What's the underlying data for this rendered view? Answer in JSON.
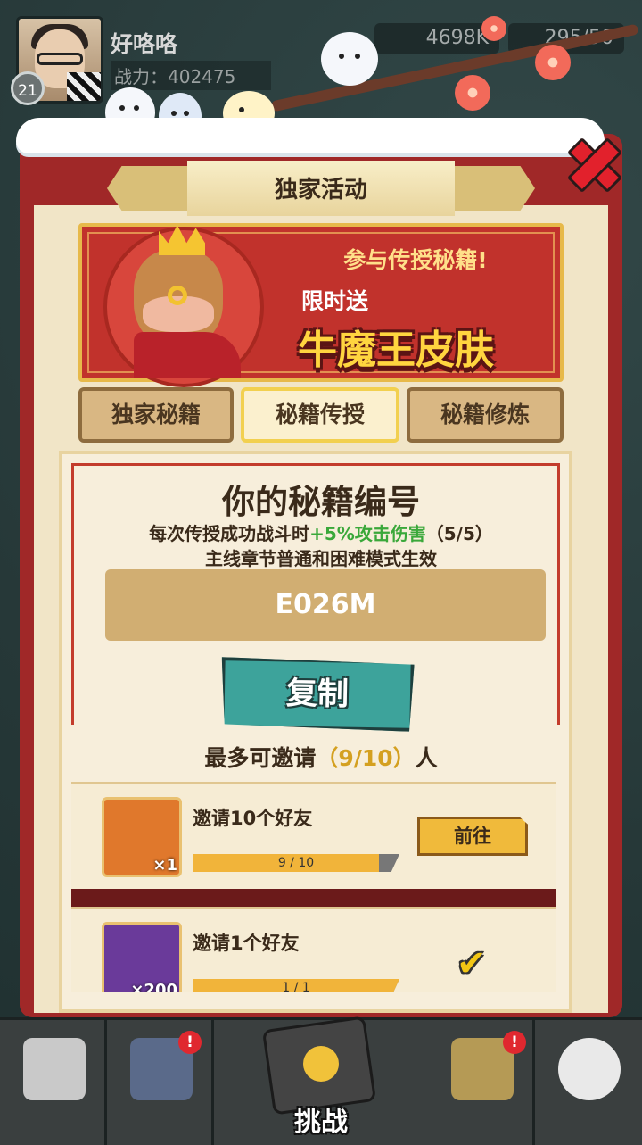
{
  "player": {
    "name": "好咯咯",
    "power": "战力：402475",
    "level": "21"
  },
  "resources": {
    "coins": "4698K",
    "energy": "295/50"
  },
  "panel": {
    "title": "独家活动"
  },
  "banner": {
    "line1": "参与传授秘籍!",
    "line2": "限时送",
    "line3": "牛魔王皮肤"
  },
  "tabs": [
    {
      "label": "独家秘籍",
      "active": false
    },
    {
      "label": "秘籍传授",
      "active": true
    },
    {
      "label": "秘籍修炼",
      "active": false
    }
  ],
  "card": {
    "title": "你的秘籍编号",
    "desc_prefix": "每次传授成功战斗时",
    "desc_bonus": "+5%攻击伤害",
    "desc_count": "（5/5）",
    "desc_line2": "主线章节普通和困难模式生效",
    "code": "E026M",
    "copy_label": "复制",
    "invite_prefix": "最多可邀请",
    "invite_count": "（9/10）",
    "invite_suffix": "人"
  },
  "tasks": [
    {
      "label": "邀请10个好友",
      "reward_count": "×1",
      "progress_text": "9 / 10",
      "progress": 0.9,
      "action": "前往",
      "done": false
    },
    {
      "label": "邀请1个好友",
      "reward_count": "×200",
      "progress_text": "1 / 1",
      "progress": 1.0,
      "action": "",
      "done": true
    }
  ],
  "nav": {
    "challenge_label": "挑战",
    "badge": "!"
  },
  "colors": {
    "panel_red": "#a02828",
    "accent_gold": "#f1b43a",
    "bonus_green": "#3aa83a",
    "copy_teal": "#3da39b"
  }
}
